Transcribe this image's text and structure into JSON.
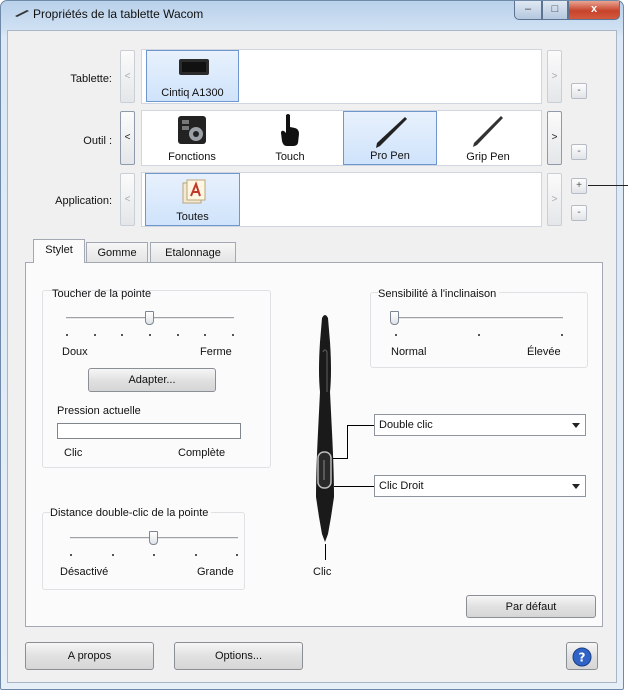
{
  "window": {
    "title": "Propriétés de la tablette Wacom",
    "caption_buttons": {
      "minimize": "–",
      "maximize": "□",
      "close": "x"
    }
  },
  "rows": {
    "tablet": {
      "label": "Tablette:",
      "prev": "<",
      "next": ">",
      "side": "-",
      "items": [
        {
          "label": "Cintiq A1300",
          "icon": "tablet-icon"
        }
      ]
    },
    "tool": {
      "label": "Outil :",
      "prev": "<",
      "next": ">",
      "side": "-",
      "items": [
        {
          "label": "Fonctions",
          "icon": "functions-icon"
        },
        {
          "label": "Touch",
          "icon": "touch-hand-icon"
        },
        {
          "label": "Pro Pen",
          "icon": "pro-pen-icon",
          "selected": true
        },
        {
          "label": "Grip Pen",
          "icon": "grip-pen-icon"
        }
      ]
    },
    "application": {
      "label": "Application:",
      "prev": "<",
      "next": ">",
      "add": "+",
      "remove": "-",
      "items": [
        {
          "label": "Toutes",
          "icon": "all-apps-icon",
          "selected": true
        }
      ]
    }
  },
  "tabs": [
    {
      "label": "Stylet",
      "active": true
    },
    {
      "label": "Gomme"
    },
    {
      "label": "Etalonnage"
    }
  ],
  "tip_feel": {
    "title": "Toucher de la pointe",
    "min_label": "Doux",
    "max_label": "Ferme",
    "level_fraction": 0.5,
    "customize_button": "Adapter...",
    "current_pressure_label": "Pression actuelle",
    "pressure_value": 0,
    "pressure_min_label": "Clic",
    "pressure_max_label": "Complète"
  },
  "double_click": {
    "title": "Distance double-clic de la pointe",
    "min_label": "Désactivé",
    "max_label": "Grande",
    "level_fraction": 0.5
  },
  "tilt": {
    "title": "Sensibilité à l'inclinaison",
    "min_label": "Normal",
    "max_label": "Élevée",
    "level_fraction": 0.0
  },
  "pen_buttons": {
    "upper": {
      "value": "Double clic"
    },
    "lower": {
      "value": "Clic Droit"
    },
    "tip_label": "Clic"
  },
  "default_button": "Par défaut",
  "footer": {
    "about_button": "A propos",
    "options_button": "Options...",
    "help_icon": "help-icon"
  }
}
